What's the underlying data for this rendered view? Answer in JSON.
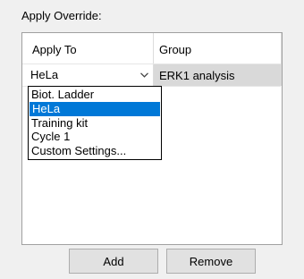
{
  "section": {
    "label": "Apply Override:"
  },
  "grid": {
    "columns": [
      "Apply To",
      "Group"
    ],
    "row": {
      "apply_to": "HeLa",
      "group": "ERK1 analysis"
    }
  },
  "dropdown": {
    "options": [
      "Biot. Ladder",
      "HeLa",
      "Training kit",
      "Cycle 1",
      "Custom Settings..."
    ],
    "selected": "HeLa"
  },
  "buttons": {
    "add": "Add",
    "remove": "Remove"
  },
  "icons": {
    "combo_arrow": "chevron-down-icon"
  },
  "colors": {
    "selection": "#0078d7",
    "group_cell_bg": "#d9d9d9"
  }
}
